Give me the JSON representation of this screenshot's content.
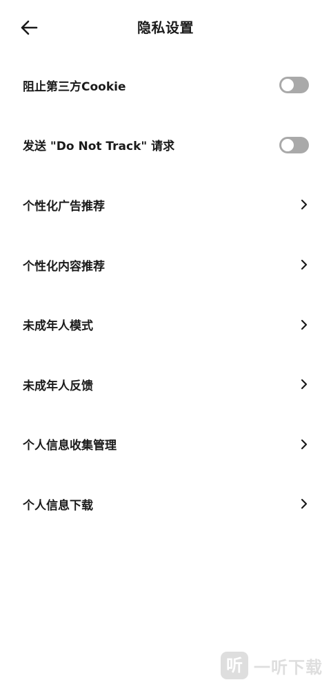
{
  "header": {
    "title": "隐私设置",
    "back_icon": "arrow-left-icon"
  },
  "settings": [
    {
      "label": "阻止第三方Cookie",
      "type": "toggle",
      "enabled": false
    },
    {
      "label": "发送 \"Do Not Track\" 请求",
      "type": "toggle",
      "enabled": false
    },
    {
      "label": "个性化广告推荐",
      "type": "link"
    },
    {
      "label": "个性化内容推荐",
      "type": "link"
    },
    {
      "label": "未成年人模式",
      "type": "link"
    },
    {
      "label": "未成年人反馈",
      "type": "link"
    },
    {
      "label": "个人信息收集管理",
      "type": "link"
    },
    {
      "label": "个人信息下载",
      "type": "link"
    }
  ],
  "watermark": {
    "logo_char": "听",
    "text": "一听下载"
  },
  "colors": {
    "toggle_off": "#a9a9a9",
    "text": "#1a1a1a",
    "background": "#ffffff"
  }
}
